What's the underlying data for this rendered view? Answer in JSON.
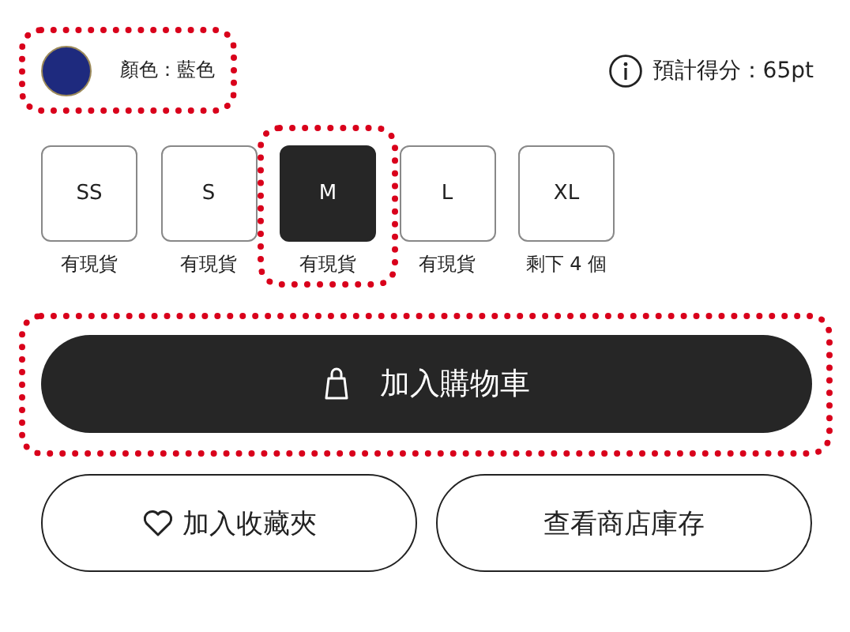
{
  "color_option": {
    "color": "#1e2a7e",
    "label": "顏色：藍色",
    "highlighted": true
  },
  "points": {
    "text": "預計得分：65pt"
  },
  "sizes": [
    {
      "label": "SS",
      "stock": "有現貨",
      "selected": false,
      "highlighted": false
    },
    {
      "label": "S",
      "stock": "有現貨",
      "selected": false,
      "highlighted": false
    },
    {
      "label": "M",
      "stock": "有現貨",
      "selected": true,
      "highlighted": true
    },
    {
      "label": "L",
      "stock": "有現貨",
      "selected": false,
      "highlighted": false
    },
    {
      "label": "XL",
      "stock": "剩下 4 個",
      "selected": false,
      "highlighted": false
    }
  ],
  "cart_button": {
    "label": "加入購物車",
    "highlighted": true
  },
  "buttons": [
    {
      "kind": "favorite",
      "label": "加入收藏夾"
    },
    {
      "kind": "stock",
      "label": "查看商店庫存"
    }
  ]
}
